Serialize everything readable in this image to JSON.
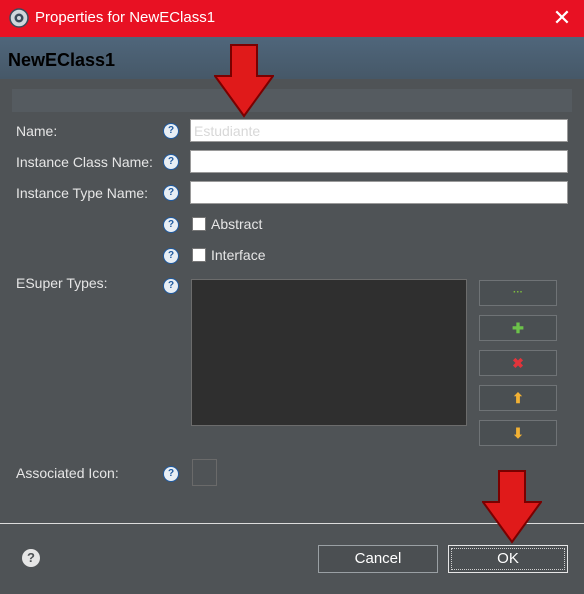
{
  "window": {
    "title": "Properties for NewEClass1",
    "close_glyph": "✕"
  },
  "header": {
    "title": "NewEClass1"
  },
  "form": {
    "name_label": "Name:",
    "name_value": "Estudiante",
    "instance_class_label": "Instance Class Name:",
    "instance_class_value": "",
    "instance_type_label": "Instance Type Name:",
    "instance_type_value": "",
    "abstract_label": "Abstract",
    "abstract_checked": false,
    "interface_label": "Interface",
    "interface_checked": false,
    "esuper_label": "ESuper Types:",
    "associated_icon_label": "Associated Icon:"
  },
  "side_buttons": [
    {
      "name": "browse-button",
      "icon": "ellipsis-icon",
      "glyph": "···",
      "color": "#7fbf3f"
    },
    {
      "name": "add-button",
      "icon": "plus-icon",
      "glyph": "✚",
      "color": "#6cc24a"
    },
    {
      "name": "remove-button",
      "icon": "red-x-icon",
      "glyph": "✖",
      "color": "#e2343b"
    },
    {
      "name": "move-up-button",
      "icon": "arrow-up-icon",
      "glyph": "⬆",
      "color": "#f2b134"
    },
    {
      "name": "move-down-button",
      "icon": "arrow-down-icon",
      "glyph": "⬇",
      "color": "#f2b134"
    }
  ],
  "footer": {
    "help_glyph": "?",
    "cancel_label": "Cancel",
    "ok_label": "OK"
  },
  "colors": {
    "accent": "#e81123",
    "annotation_arrow": "#e01a1a"
  }
}
